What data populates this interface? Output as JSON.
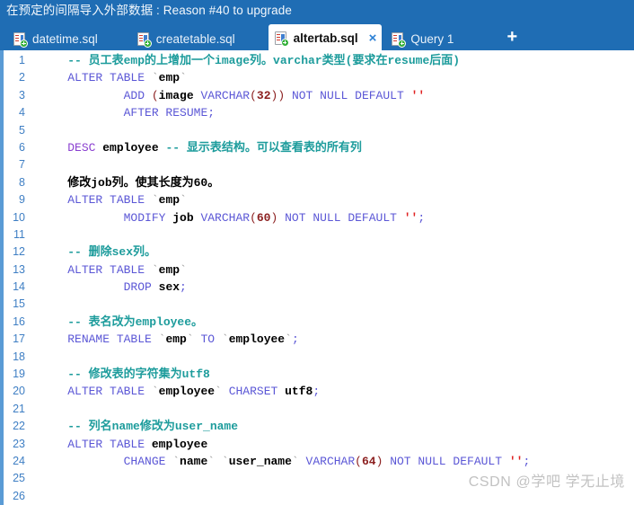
{
  "promo": {
    "text": "在预定的间隔导入外部数据 : Reason #40 to upgrade"
  },
  "tabs": {
    "items": [
      {
        "label": "datetime.sql",
        "icon": "sql-file-icon",
        "active": false
      },
      {
        "label": "createtable.sql",
        "icon": "sql-file-icon",
        "active": false
      },
      {
        "label": "altertab.sql",
        "icon": "sql-file-icon",
        "active": true,
        "close": "×"
      },
      {
        "label": "Query 1",
        "icon": "sql-file-icon",
        "active": false
      }
    ],
    "add_label": "+"
  },
  "editor": {
    "lines": [
      {
        "n": "1",
        "tokens": [
          {
            "t": "plain",
            "v": "    "
          },
          {
            "t": "com",
            "v": "-- 员工表emp的上增加一个image列。varchar类型(要求在resume后面)"
          }
        ]
      },
      {
        "n": "2",
        "tokens": [
          {
            "t": "plain",
            "v": "    "
          },
          {
            "t": "kw",
            "v": "ALTER TABLE "
          },
          {
            "t": "tick",
            "v": "`"
          },
          {
            "t": "id",
            "v": "emp"
          },
          {
            "t": "tick",
            "v": "`"
          }
        ]
      },
      {
        "n": "3",
        "tokens": [
          {
            "t": "plain",
            "v": "            "
          },
          {
            "t": "kw",
            "v": "ADD "
          },
          {
            "t": "punc",
            "v": "("
          },
          {
            "t": "id",
            "v": "image"
          },
          {
            "t": "plain",
            "v": " "
          },
          {
            "t": "kw",
            "v": "VARCHAR"
          },
          {
            "t": "punc",
            "v": "("
          },
          {
            "t": "num",
            "v": "32"
          },
          {
            "t": "punc",
            "v": "))"
          },
          {
            "t": "plain",
            "v": " "
          },
          {
            "t": "kw",
            "v": "NOT NULL DEFAULT"
          },
          {
            "t": "plain",
            "v": " "
          },
          {
            "t": "str",
            "v": "''"
          }
        ]
      },
      {
        "n": "4",
        "tokens": [
          {
            "t": "plain",
            "v": "            "
          },
          {
            "t": "kw",
            "v": "AFTER RESUME"
          },
          {
            "t": "semi",
            "v": ";"
          }
        ]
      },
      {
        "n": "5",
        "tokens": []
      },
      {
        "n": "6",
        "tokens": [
          {
            "t": "plain",
            "v": "    "
          },
          {
            "t": "kw2",
            "v": "DESC "
          },
          {
            "t": "id",
            "v": "employee"
          },
          {
            "t": "plain",
            "v": " "
          },
          {
            "t": "com",
            "v": "-- 显示表结构。可以查看表的所有列"
          }
        ]
      },
      {
        "n": "7",
        "tokens": []
      },
      {
        "n": "8",
        "tokens": [
          {
            "t": "plain",
            "v": "    "
          },
          {
            "t": "bold",
            "v": "修改job列。使其长度为60。"
          }
        ]
      },
      {
        "n": "9",
        "tokens": [
          {
            "t": "plain",
            "v": "    "
          },
          {
            "t": "kw",
            "v": "ALTER TABLE "
          },
          {
            "t": "tick",
            "v": "`"
          },
          {
            "t": "id",
            "v": "emp"
          },
          {
            "t": "tick",
            "v": "`"
          }
        ]
      },
      {
        "n": "10",
        "tokens": [
          {
            "t": "plain",
            "v": "            "
          },
          {
            "t": "kw",
            "v": "MODIFY "
          },
          {
            "t": "id",
            "v": "job"
          },
          {
            "t": "plain",
            "v": " "
          },
          {
            "t": "kw",
            "v": "VARCHAR"
          },
          {
            "t": "punc",
            "v": "("
          },
          {
            "t": "num",
            "v": "60"
          },
          {
            "t": "punc",
            "v": ")"
          },
          {
            "t": "plain",
            "v": " "
          },
          {
            "t": "kw",
            "v": "NOT NULL DEFAULT"
          },
          {
            "t": "plain",
            "v": " "
          },
          {
            "t": "str",
            "v": "''"
          },
          {
            "t": "semi",
            "v": ";"
          }
        ]
      },
      {
        "n": "11",
        "tokens": []
      },
      {
        "n": "12",
        "tokens": [
          {
            "t": "plain",
            "v": "    "
          },
          {
            "t": "com",
            "v": "-- 删除sex列。"
          }
        ]
      },
      {
        "n": "13",
        "tokens": [
          {
            "t": "plain",
            "v": "    "
          },
          {
            "t": "kw",
            "v": "ALTER TABLE "
          },
          {
            "t": "tick",
            "v": "`"
          },
          {
            "t": "id",
            "v": "emp"
          },
          {
            "t": "tick",
            "v": "`"
          }
        ]
      },
      {
        "n": "14",
        "tokens": [
          {
            "t": "plain",
            "v": "            "
          },
          {
            "t": "kw",
            "v": "DROP "
          },
          {
            "t": "id",
            "v": "sex"
          },
          {
            "t": "semi",
            "v": ";"
          }
        ]
      },
      {
        "n": "15",
        "tokens": []
      },
      {
        "n": "16",
        "tokens": [
          {
            "t": "plain",
            "v": "    "
          },
          {
            "t": "com",
            "v": "-- 表名改为employee。"
          }
        ]
      },
      {
        "n": "17",
        "tokens": [
          {
            "t": "plain",
            "v": "    "
          },
          {
            "t": "kw",
            "v": "RENAME TABLE "
          },
          {
            "t": "tick",
            "v": "`"
          },
          {
            "t": "id",
            "v": "emp"
          },
          {
            "t": "tick",
            "v": "`"
          },
          {
            "t": "plain",
            "v": " "
          },
          {
            "t": "kw",
            "v": "TO "
          },
          {
            "t": "tick",
            "v": "`"
          },
          {
            "t": "id",
            "v": "employee"
          },
          {
            "t": "tick",
            "v": "`"
          },
          {
            "t": "semi",
            "v": ";"
          }
        ]
      },
      {
        "n": "18",
        "tokens": []
      },
      {
        "n": "19",
        "tokens": [
          {
            "t": "plain",
            "v": "    "
          },
          {
            "t": "com",
            "v": "-- 修改表的字符集为utf8"
          }
        ]
      },
      {
        "n": "20",
        "tokens": [
          {
            "t": "plain",
            "v": "    "
          },
          {
            "t": "kw",
            "v": "ALTER TABLE "
          },
          {
            "t": "tick",
            "v": "`"
          },
          {
            "t": "id",
            "v": "employee"
          },
          {
            "t": "tick",
            "v": "`"
          },
          {
            "t": "plain",
            "v": " "
          },
          {
            "t": "kw",
            "v": "CHARSET "
          },
          {
            "t": "id",
            "v": "utf8"
          },
          {
            "t": "semi",
            "v": ";"
          }
        ]
      },
      {
        "n": "21",
        "tokens": []
      },
      {
        "n": "22",
        "tokens": [
          {
            "t": "plain",
            "v": "    "
          },
          {
            "t": "com",
            "v": "-- 列名name修改为user_name"
          }
        ]
      },
      {
        "n": "23",
        "tokens": [
          {
            "t": "plain",
            "v": "    "
          },
          {
            "t": "kw",
            "v": "ALTER TABLE "
          },
          {
            "t": "id",
            "v": "employee"
          }
        ]
      },
      {
        "n": "24",
        "tokens": [
          {
            "t": "plain",
            "v": "            "
          },
          {
            "t": "kw",
            "v": "CHANGE "
          },
          {
            "t": "tick",
            "v": "`"
          },
          {
            "t": "id",
            "v": "name"
          },
          {
            "t": "tick",
            "v": "`"
          },
          {
            "t": "plain",
            "v": " "
          },
          {
            "t": "tick",
            "v": "`"
          },
          {
            "t": "id",
            "v": "user_name"
          },
          {
            "t": "tick",
            "v": "`"
          },
          {
            "t": "plain",
            "v": " "
          },
          {
            "t": "kw",
            "v": "VARCHAR"
          },
          {
            "t": "punc",
            "v": "("
          },
          {
            "t": "num",
            "v": "64"
          },
          {
            "t": "punc",
            "v": ")"
          },
          {
            "t": "plain",
            "v": " "
          },
          {
            "t": "kw",
            "v": "NOT NULL DEFAULT"
          },
          {
            "t": "plain",
            "v": " "
          },
          {
            "t": "str",
            "v": "''"
          },
          {
            "t": "semi",
            "v": ";"
          }
        ]
      },
      {
        "n": "25",
        "tokens": []
      },
      {
        "n": "26",
        "tokens": []
      }
    ]
  },
  "watermark": {
    "text": "CSDN @学吧 学无止境"
  },
  "colors": {
    "header_blue": "#1f6db4",
    "rail_blue": "#5a9bd5",
    "gutter_blue": "#3f7fc4",
    "comment_teal": "#1d9c9c",
    "keyword_blue": "#5b57d6",
    "keyword_purple": "#8a3fd0",
    "number_maroon": "#8c2020",
    "string_red": "#e02020",
    "watermark_gray": "#c2c2c2"
  }
}
